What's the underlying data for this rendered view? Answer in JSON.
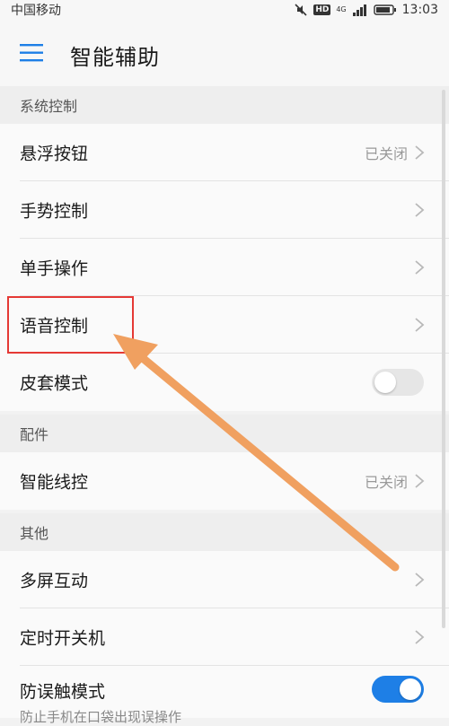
{
  "status_bar": {
    "carrier": "中国移动",
    "hd": "HD",
    "network": "4G",
    "time": "13:03"
  },
  "toolbar": {
    "title": "智能辅助"
  },
  "sections": {
    "system": {
      "header": "系统控制",
      "items": [
        {
          "label": "悬浮按钮",
          "value": "已关闭"
        },
        {
          "label": "手势控制"
        },
        {
          "label": "单手操作"
        },
        {
          "label": "语音控制"
        },
        {
          "label": "皮套模式",
          "toggle": false
        }
      ]
    },
    "accessories": {
      "header": "配件",
      "items": [
        {
          "label": "智能线控",
          "value": "已关闭"
        }
      ]
    },
    "other": {
      "header": "其他",
      "items": [
        {
          "label": "多屏互动"
        },
        {
          "label": "定时开关机"
        },
        {
          "label": "防误触模式",
          "subtitle": "防止手机在口袋出现误操作",
          "toggle": true
        }
      ]
    }
  },
  "annotation": {
    "highlight_color": "#e53935",
    "arrow_color": "#f0a060"
  },
  "accent_color": "#1e7fe6"
}
